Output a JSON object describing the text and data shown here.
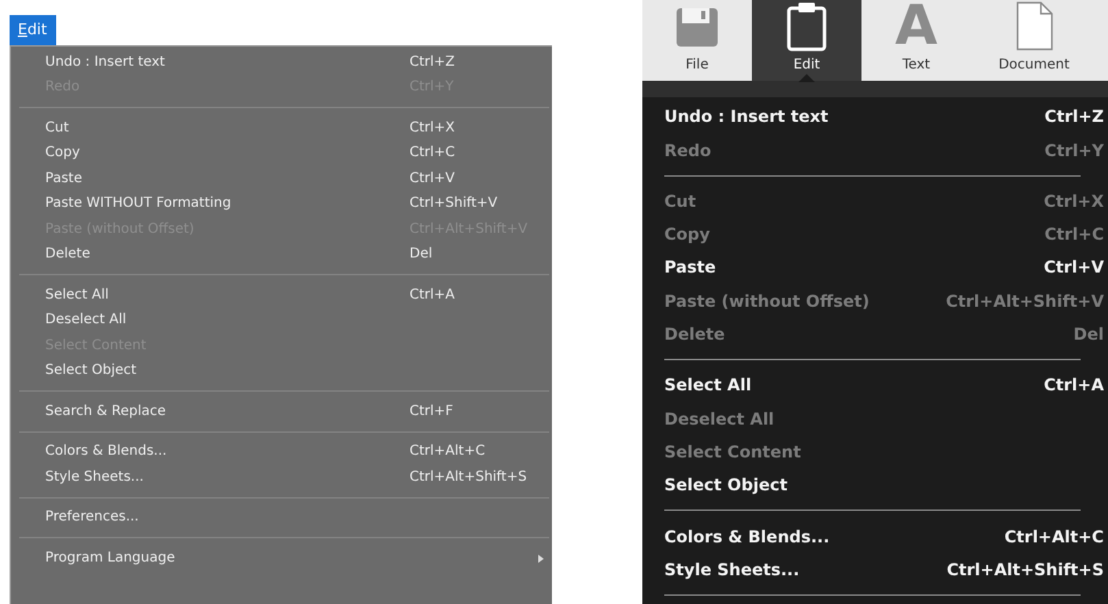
{
  "left_menu": {
    "title": "Edit",
    "groups": [
      [
        {
          "label": "Undo : Insert text",
          "shortcut": "Ctrl+Z",
          "disabled": false
        },
        {
          "label": "Redo",
          "shortcut": "Ctrl+Y",
          "disabled": true
        }
      ],
      [
        {
          "label": "Cut",
          "shortcut": "Ctrl+X",
          "disabled": false
        },
        {
          "label": "Copy",
          "shortcut": "Ctrl+C",
          "disabled": false
        },
        {
          "label": "Paste",
          "shortcut": "Ctrl+V",
          "disabled": false
        },
        {
          "label": "Paste WITHOUT Formatting",
          "shortcut": "Ctrl+Shift+V",
          "disabled": false
        },
        {
          "label": "Paste (without Offset)",
          "shortcut": "Ctrl+Alt+Shift+V",
          "disabled": true
        },
        {
          "label": "Delete",
          "shortcut": "Del",
          "disabled": false
        }
      ],
      [
        {
          "label": "Select All",
          "shortcut": "Ctrl+A",
          "disabled": false
        },
        {
          "label": "Deselect All",
          "disabled": false
        },
        {
          "label": "Select Content",
          "disabled": true
        },
        {
          "label": "Select Object",
          "disabled": false
        }
      ],
      [
        {
          "label": "Search & Replace",
          "shortcut": "Ctrl+F",
          "disabled": false
        }
      ],
      [
        {
          "label": "Colors & Blends...",
          "shortcut": "Ctrl+Alt+C",
          "disabled": false
        },
        {
          "label": "Style Sheets...",
          "shortcut": "Ctrl+Alt+Shift+S",
          "disabled": false
        }
      ],
      [
        {
          "label": "Preferences...",
          "disabled": false
        }
      ],
      [
        {
          "label": "Program Language",
          "disabled": false,
          "submenu": true
        }
      ]
    ]
  },
  "right_app": {
    "toolbar": [
      {
        "label": "File",
        "kind": "floppy",
        "selected": false
      },
      {
        "label": "Edit",
        "kind": "clipboard",
        "selected": true
      },
      {
        "label": "Text",
        "kind": "letter",
        "glyph": "A",
        "selected": false
      },
      {
        "label": "Document",
        "kind": "page",
        "selected": false
      }
    ],
    "menu_groups": [
      [
        {
          "label": "Undo : Insert text",
          "shortcut": "Ctrl+Z",
          "disabled": false
        },
        {
          "label": "Redo",
          "shortcut": "Ctrl+Y",
          "disabled": true
        }
      ],
      [
        {
          "label": "Cut",
          "shortcut": "Ctrl+X",
          "disabled": true
        },
        {
          "label": "Copy",
          "shortcut": "Ctrl+C",
          "disabled": true
        },
        {
          "label": "Paste",
          "shortcut": "Ctrl+V",
          "disabled": false
        },
        {
          "label": "Paste (without Offset)",
          "shortcut": "Ctrl+Alt+Shift+V",
          "disabled": true
        },
        {
          "label": "Delete",
          "shortcut": "Del",
          "disabled": true
        }
      ],
      [
        {
          "label": "Select All",
          "shortcut": "Ctrl+A",
          "disabled": false
        },
        {
          "label": "Deselect All",
          "disabled": true
        },
        {
          "label": "Select Content",
          "disabled": true
        },
        {
          "label": "Select Object",
          "disabled": false
        }
      ],
      [
        {
          "label": "Colors & Blends...",
          "shortcut": "Ctrl+Alt+C",
          "disabled": false
        },
        {
          "label": "Style Sheets...",
          "shortcut": "Ctrl+Alt+Shift+S",
          "disabled": false
        }
      ]
    ]
  }
}
